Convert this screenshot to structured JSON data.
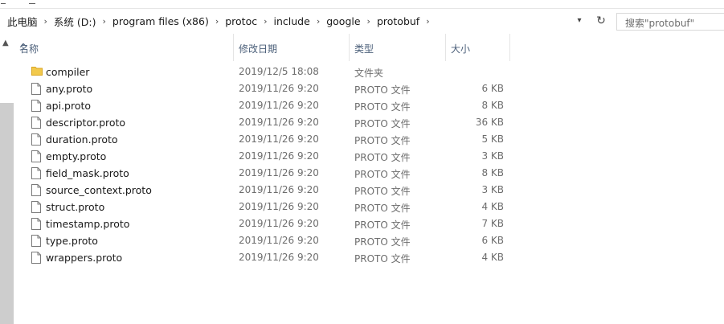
{
  "address_bar": {
    "crumbs": [
      "此电脑",
      "系统 (D:)",
      "program files (x86)",
      "protoc",
      "include",
      "google",
      "protobuf"
    ]
  },
  "search": {
    "placeholder": "搜索\"protobuf\""
  },
  "columns": {
    "name": "名称",
    "date": "修改日期",
    "type": "类型",
    "size": "大小"
  },
  "files": [
    {
      "name": "compiler",
      "date": "2019/12/5 18:08",
      "type": "文件夹",
      "size": "",
      "icon": "folder-icon"
    },
    {
      "name": "any.proto",
      "date": "2019/11/26 9:20",
      "type": "PROTO 文件",
      "size": "6 KB",
      "icon": "file-icon"
    },
    {
      "name": "api.proto",
      "date": "2019/11/26 9:20",
      "type": "PROTO 文件",
      "size": "8 KB",
      "icon": "file-icon"
    },
    {
      "name": "descriptor.proto",
      "date": "2019/11/26 9:20",
      "type": "PROTO 文件",
      "size": "36 KB",
      "icon": "file-icon"
    },
    {
      "name": "duration.proto",
      "date": "2019/11/26 9:20",
      "type": "PROTO 文件",
      "size": "5 KB",
      "icon": "file-icon"
    },
    {
      "name": "empty.proto",
      "date": "2019/11/26 9:20",
      "type": "PROTO 文件",
      "size": "3 KB",
      "icon": "file-icon"
    },
    {
      "name": "field_mask.proto",
      "date": "2019/11/26 9:20",
      "type": "PROTO 文件",
      "size": "8 KB",
      "icon": "file-icon"
    },
    {
      "name": "source_context.proto",
      "date": "2019/11/26 9:20",
      "type": "PROTO 文件",
      "size": "3 KB",
      "icon": "file-icon"
    },
    {
      "name": "struct.proto",
      "date": "2019/11/26 9:20",
      "type": "PROTO 文件",
      "size": "4 KB",
      "icon": "file-icon"
    },
    {
      "name": "timestamp.proto",
      "date": "2019/11/26 9:20",
      "type": "PROTO 文件",
      "size": "7 KB",
      "icon": "file-icon"
    },
    {
      "name": "type.proto",
      "date": "2019/11/26 9:20",
      "type": "PROTO 文件",
      "size": "6 KB",
      "icon": "file-icon"
    },
    {
      "name": "wrappers.proto",
      "date": "2019/11/26 9:20",
      "type": "PROTO 文件",
      "size": "4 KB",
      "icon": "file-icon"
    }
  ],
  "colors": {
    "header_text": "#4c607a",
    "detail_text": "#6d6d6d",
    "folder": "#f2c94c",
    "scrollbar": "#cdcdcd"
  }
}
